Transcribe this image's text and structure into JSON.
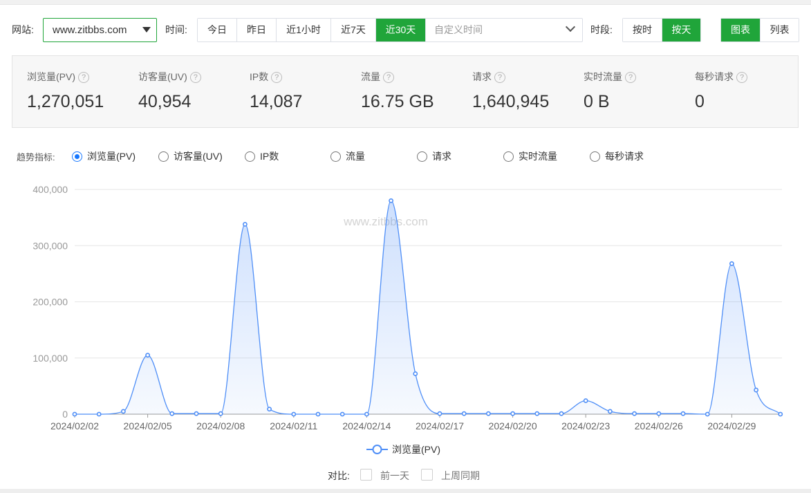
{
  "toolbar": {
    "site_label": "网站:",
    "site_value": "www.zitbbs.com",
    "time_label": "时间:",
    "time_buttons": [
      "今日",
      "昨日",
      "近1小时",
      "近7天",
      "近30天"
    ],
    "time_active": "近30天",
    "custom_time_placeholder": "自定义时间",
    "period_label": "时段:",
    "period_buttons": [
      "按时",
      "按天"
    ],
    "period_active": "按天",
    "view_buttons": [
      "图表",
      "列表"
    ],
    "view_active": "图表"
  },
  "stats": [
    {
      "name": "浏览量(PV)",
      "value": "1,270,051"
    },
    {
      "name": "访客量(UV)",
      "value": "40,954"
    },
    {
      "name": "IP数",
      "value": "14,087"
    },
    {
      "name": "流量",
      "value": "16.75 GB"
    },
    {
      "name": "请求",
      "value": "1,640,945"
    },
    {
      "name": "实时流量",
      "value": "0 B"
    },
    {
      "name": "每秒请求",
      "value": "0"
    }
  ],
  "help_glyph": "?",
  "trend": {
    "label": "趋势指标:",
    "options": [
      "浏览量(PV)",
      "访客量(UV)",
      "IP数",
      "流量",
      "请求",
      "实时流量",
      "每秒请求"
    ],
    "selected": "浏览量(PV)"
  },
  "compare": {
    "label": "对比:",
    "options": [
      "前一天",
      "上周同期"
    ]
  },
  "colors": {
    "accent_green": "#20a53a",
    "series_blue": "#4e8ef7"
  },
  "chart_data": {
    "type": "area",
    "watermark": "www.zitbbs.com",
    "x": [
      "2024/02/02",
      "2024/02/03",
      "2024/02/04",
      "2024/02/05",
      "2024/02/06",
      "2024/02/07",
      "2024/02/08",
      "2024/02/09",
      "2024/02/10",
      "2024/02/11",
      "2024/02/12",
      "2024/02/13",
      "2024/02/14",
      "2024/02/15",
      "2024/02/16",
      "2024/02/17",
      "2024/02/18",
      "2024/02/19",
      "2024/02/20",
      "2024/02/21",
      "2024/02/22",
      "2024/02/23",
      "2024/02/24",
      "2024/02/25",
      "2024/02/26",
      "2024/02/27",
      "2024/02/28",
      "2024/02/29",
      "2024/03/01",
      "2024/03/02"
    ],
    "x_tick_labels": [
      "2024/02/02",
      "2024/02/05",
      "2024/02/08",
      "2024/02/11",
      "2024/02/14",
      "2024/02/17",
      "2024/02/20",
      "2024/02/23",
      "2024/02/26",
      "2024/02/29"
    ],
    "series": [
      {
        "name": "浏览量(PV)",
        "values": [
          0,
          0,
          5000,
          105000,
          1000,
          1000,
          1000,
          338000,
          9000,
          0,
          0,
          0,
          0,
          380000,
          72000,
          1000,
          1000,
          1000,
          1000,
          1000,
          1000,
          24000,
          5000,
          1000,
          1000,
          1000,
          0,
          268000,
          43000,
          0
        ]
      }
    ],
    "y_ticks": [
      "0",
      "100,000",
      "200,000",
      "300,000",
      "400,000"
    ],
    "ylim": [
      0,
      400000
    ],
    "grid": true,
    "legend": "bottom-center"
  }
}
